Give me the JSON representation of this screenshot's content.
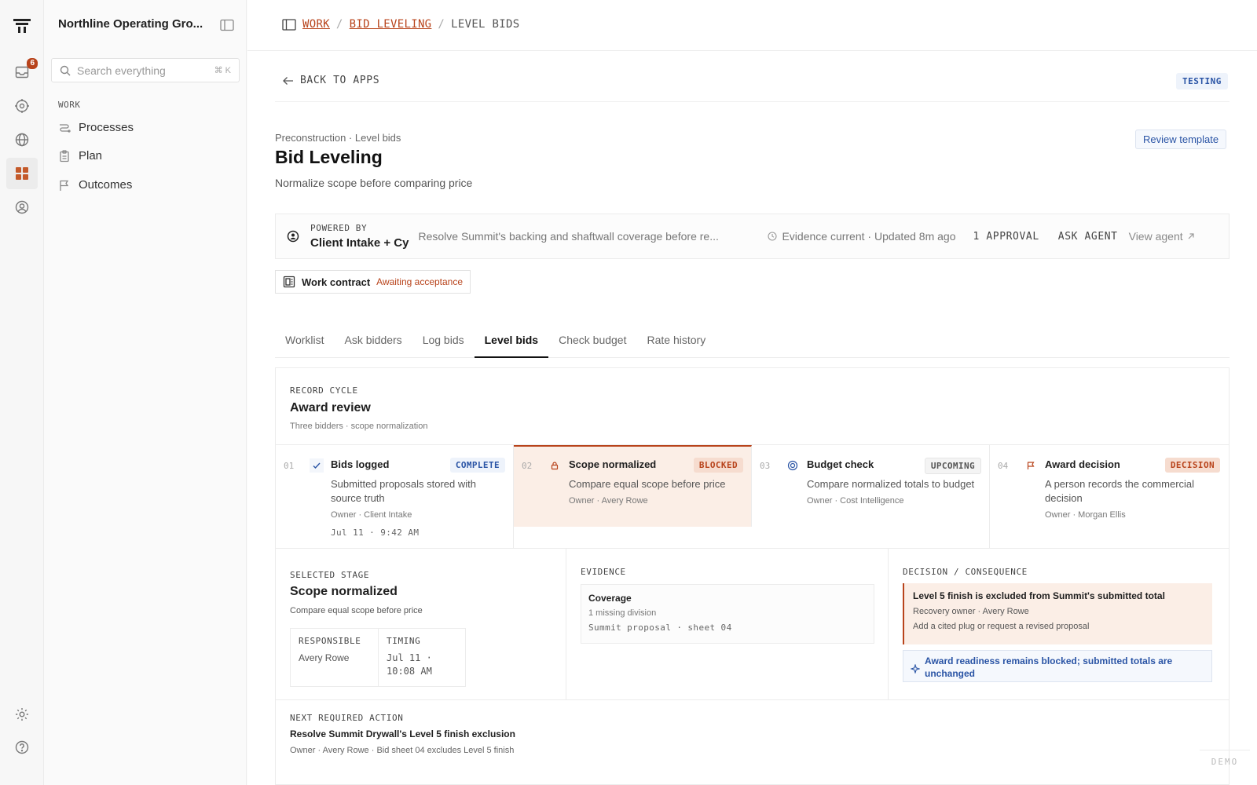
{
  "rail": {
    "inbox_badge": "6",
    "icons": [
      "logo-icon",
      "inbox-icon",
      "target-icon",
      "globe-icon",
      "apps-icon",
      "profile-icon",
      "settings-icon",
      "help-icon"
    ]
  },
  "sidebar": {
    "org": "Northline Operating Gro...",
    "search_placeholder": "Search everything",
    "search_shortcut": "⌘ K",
    "section": "WORK",
    "items": [
      {
        "label": "Processes"
      },
      {
        "label": "Plan"
      },
      {
        "label": "Outcomes"
      }
    ]
  },
  "breadcrumb": {
    "work": "WORK",
    "sep": "/",
    "bid_leveling": "BID LEVELING",
    "current": "LEVEL BIDS"
  },
  "header": {
    "back": "BACK TO APPS",
    "env": "TESTING",
    "kicker": "Preconstruction · Level bids",
    "title": "Bid Leveling",
    "subtitle": "Normalize scope before comparing price",
    "review_template": "Review template"
  },
  "agent": {
    "powered_by": "POWERED BY",
    "name": "Client Intake + Cy",
    "message": "Resolve Summit's backing and shaftwall coverage before re...",
    "evidence": "Evidence current · Updated 8m ago",
    "approval": "1 APPROVAL",
    "ask": "ASK AGENT",
    "view": "View agent"
  },
  "contract": {
    "label": "Work contract",
    "status": "Awaiting acceptance"
  },
  "tabs": [
    "Worklist",
    "Ask bidders",
    "Log bids",
    "Level bids",
    "Check budget",
    "Rate history"
  ],
  "active_tab": "Level bids",
  "cycle": {
    "label": "RECORD CYCLE",
    "title": "Award review",
    "subtitle": "Three bidders · scope normalization"
  },
  "stages": [
    {
      "num": "01",
      "name": "Bids logged",
      "status": "COMPLETE",
      "desc": "Submitted proposals stored with source truth",
      "owner": "Owner · Client Intake",
      "when": "Jul 11 · 9:42 AM"
    },
    {
      "num": "02",
      "name": "Scope normalized",
      "status": "BLOCKED",
      "desc": "Compare equal scope before price",
      "owner": "Owner · Avery Rowe",
      "when": ""
    },
    {
      "num": "03",
      "name": "Budget check",
      "status": "UPCOMING",
      "desc": "Compare normalized totals to budget",
      "owner": "Owner · Cost Intelligence",
      "when": ""
    },
    {
      "num": "04",
      "name": "Award decision",
      "status": "DECISION",
      "desc": "A person records the commercial decision",
      "owner": "Owner · Morgan Ellis",
      "when": ""
    }
  ],
  "selected": {
    "label": "SELECTED STAGE",
    "title": "Scope normalized",
    "subtitle": "Compare equal scope before price",
    "responsible_label": "RESPONSIBLE",
    "responsible": "Avery Rowe",
    "timing_label": "TIMING",
    "timing": "Jul 11 · 10:08 AM"
  },
  "evidence": {
    "label": "EVIDENCE",
    "title": "Coverage",
    "meta": "1 missing division",
    "ref": "Summit proposal · sheet 04"
  },
  "decision": {
    "label": "DECISION / CONSEQUENCE",
    "title": "Level 5 finish is excluded from Summit's submitted total",
    "owner": "Recovery owner · Avery Rowe",
    "action": "Add a cited plug or request a revised proposal",
    "note": "Award readiness remains blocked; submitted totals are unchanged"
  },
  "next": {
    "label": "NEXT REQUIRED ACTION",
    "title": "Resolve Summit Drywall's Level 5 finish exclusion",
    "sub": "Owner · Avery Rowe · Bid sheet 04 excludes Level 5 finish"
  },
  "demo": "DEMO",
  "colors": {
    "accent": "#b8431b",
    "blue": "#2a54a5",
    "blocked_bg": "#fbeee6"
  }
}
